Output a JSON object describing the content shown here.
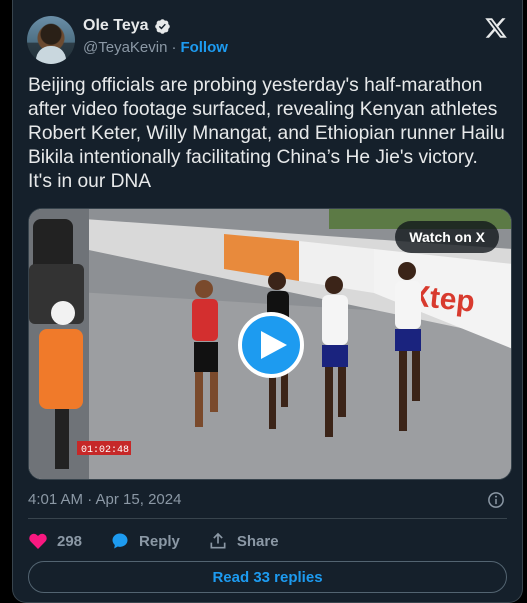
{
  "author": {
    "name": "Ole Teya",
    "handle": "@TeyaKevin",
    "separator": "·",
    "follow_label": "Follow"
  },
  "tweet": {
    "text": "Beijing officials are probing yesterday's half-marathon\nafter video footage surfaced, revealing Kenyan athletes\nRobert Keter, Willy Mnangat, and Ethiopian runner Hailu\nBikila intentionally facilitating China’s He Jie's victory.\nIt's in our DNA"
  },
  "media": {
    "watch_label": "Watch on X",
    "video_clock": "01:02:48",
    "banner_text": "Xtep"
  },
  "timestamp": "4:01 AM · Apr 15, 2024",
  "actions": {
    "like_count": "298",
    "reply_label": "Reply",
    "share_label": "Share"
  },
  "read_replies_label": "Read 33 replies",
  "colors": {
    "accent": "#1d9bf0",
    "like": "#f91880",
    "background": "#15202b"
  }
}
